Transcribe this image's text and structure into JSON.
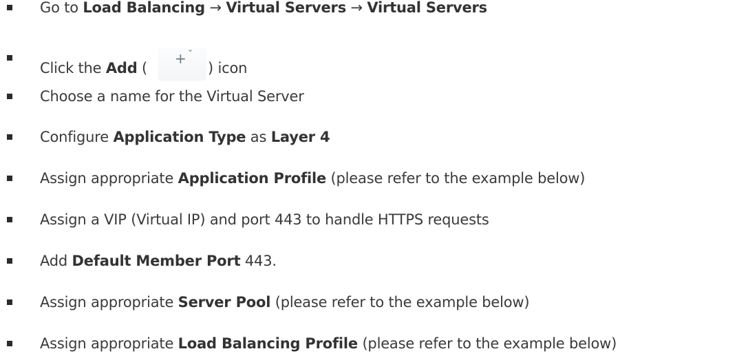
{
  "steps": [
    {
      "parts": [
        {
          "t": "Go to ",
          "b": false
        },
        {
          "t": "Load Balancing",
          "b": true
        },
        {
          "t": " → ",
          "b": false
        },
        {
          "t": "Virtual Servers",
          "b": true
        },
        {
          "t": " → ",
          "b": false
        },
        {
          "t": "Virtual Servers",
          "b": true
        }
      ]
    },
    {
      "parts": [
        {
          "t": "Click the ",
          "b": false
        },
        {
          "t": "Add",
          "b": true
        },
        {
          "t": " (",
          "b": false
        },
        {
          "icon": "add-dropdown-icon"
        },
        {
          "t": ") icon",
          "b": false
        }
      ]
    },
    {
      "parts": [
        {
          "t": "Choose a name for the Virtual Server",
          "b": false
        }
      ]
    },
    {
      "parts": [
        {
          "t": "Configure ",
          "b": false
        },
        {
          "t": "Application Type",
          "b": true
        },
        {
          "t": " as ",
          "b": false
        },
        {
          "t": "Layer 4",
          "b": true
        }
      ]
    },
    {
      "parts": [
        {
          "t": "Assign appropriate ",
          "b": false
        },
        {
          "t": "Application Profile",
          "b": true
        },
        {
          "t": " (please refer to the example below)",
          "b": false
        }
      ]
    },
    {
      "parts": [
        {
          "t": "Assign a VIP (Virtual IP) and port 443 to handle HTTPS requests",
          "b": false
        }
      ]
    },
    {
      "parts": [
        {
          "t": "Add ",
          "b": false
        },
        {
          "t": "Default Member Port",
          "b": true
        },
        {
          "t": " 443.",
          "b": false
        }
      ]
    },
    {
      "parts": [
        {
          "t": "Assign appropriate ",
          "b": false
        },
        {
          "t": "Server Pool",
          "b": true
        },
        {
          "t": " (please refer to the example below)",
          "b": false
        }
      ]
    },
    {
      "parts": [
        {
          "t": "Assign appropriate ",
          "b": false
        },
        {
          "t": "Load Balancing Profile",
          "b": true
        },
        {
          "t": " (please refer to the example below)",
          "b": false
        }
      ]
    }
  ],
  "icons": {
    "add_plus": "+",
    "add_chevron": "ˇ"
  }
}
